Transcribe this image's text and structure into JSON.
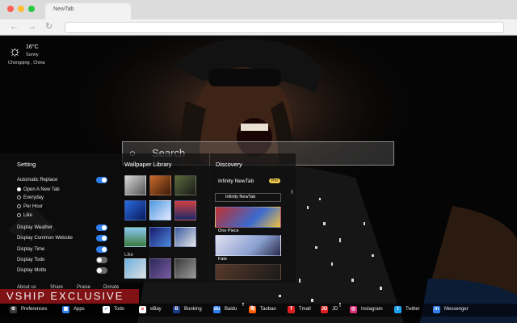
{
  "browser": {
    "tab_title": "NewTab",
    "back": "←",
    "forward": "→",
    "reload": "↻"
  },
  "weather": {
    "icon": "sun-icon",
    "temp": "16°C",
    "desc": "Sunny",
    "city": "Chongqing , China"
  },
  "search": {
    "placeholder": "Search"
  },
  "setting": {
    "title": "Setting",
    "auto_replace": "Automatic Replace",
    "options": [
      "Open A New Tab",
      "Everyday",
      "Per Hour",
      "Like"
    ],
    "selected_option": "Open A New Tab",
    "toggles": [
      {
        "label": "Display Weather",
        "on": true
      },
      {
        "label": "Display Common Website",
        "on": true
      },
      {
        "label": "Display Time",
        "on": true
      },
      {
        "label": "Display Todo",
        "on": false
      },
      {
        "label": "Display Motto",
        "on": false
      }
    ],
    "links": [
      "About us",
      "Share",
      "Praise",
      "Donate"
    ]
  },
  "wallpaper_library": {
    "title": "Wallpaper Library",
    "like_label": "Like"
  },
  "discovery": {
    "title": "Discovery",
    "infinity_name": "Infinity NewTab",
    "pro_badge": "Pro",
    "infinity_row": "Infinity NewTab",
    "cards": [
      "One Piece",
      "Fate"
    ]
  },
  "logo_text": "VSHIP EXCLUSIVE",
  "bottom_bar": [
    {
      "label": "Preferences",
      "icon": "gear-icon",
      "color": "#3a3a3a"
    },
    {
      "label": "Apps",
      "icon": "apps-icon",
      "color": "#2f7ff0"
    },
    {
      "label": "Todo",
      "icon": "check-icon",
      "color": "#ffffff"
    },
    {
      "label": "eBay",
      "icon": "ebay-icon",
      "color": "#ffffff"
    },
    {
      "label": "Booking",
      "icon": "booking-icon",
      "color": "#1a3a8a"
    },
    {
      "label": "Baidu",
      "icon": "baidu-icon",
      "color": "#2f7ff0"
    },
    {
      "label": "Taobao",
      "icon": "taobao-icon",
      "color": "#ff5a00"
    },
    {
      "label": "Tmall",
      "icon": "tmall-icon",
      "color": "#e02020"
    },
    {
      "label": "JD",
      "icon": "jd-icon",
      "color": "#e02020"
    },
    {
      "label": "Instagram",
      "icon": "instagram-icon",
      "color": "#d8307a"
    },
    {
      "label": "Twitter",
      "icon": "twitter-icon",
      "color": "#1da1f2"
    },
    {
      "label": "Messenger",
      "icon": "messenger-icon",
      "color": "#2f7ff0"
    }
  ]
}
